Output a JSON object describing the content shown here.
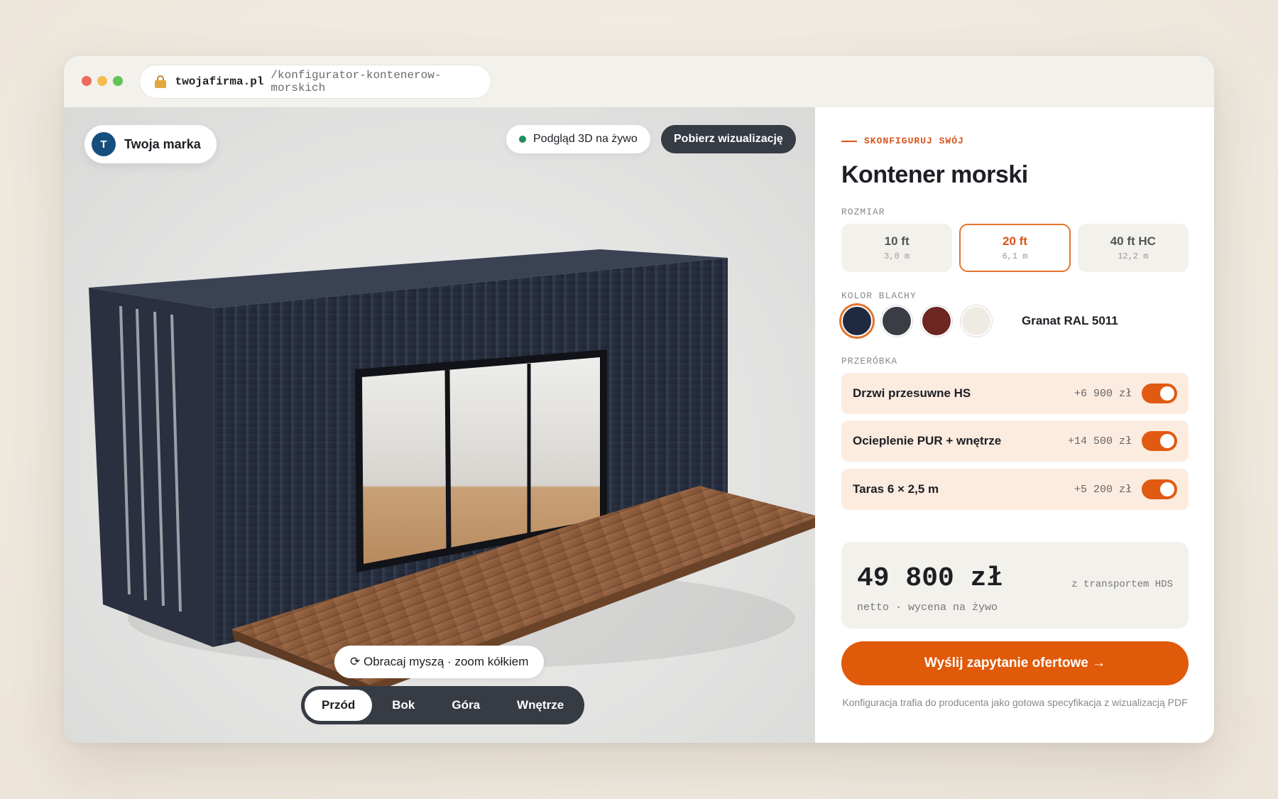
{
  "browser": {
    "domain": "twojafirma.pl",
    "path": "/konfigurator-kontenerow-morskich"
  },
  "viewer": {
    "brand": {
      "initial": "T",
      "name": "Twoja marka"
    },
    "live_label": "Podgląd 3D na żywo",
    "download_label": "Pobierz wizualizację",
    "hint": "⟳ Obracaj myszą · zoom kółkiem",
    "views": [
      {
        "label": "Przód",
        "active": true
      },
      {
        "label": "Bok",
        "active": false
      },
      {
        "label": "Góra",
        "active": false
      },
      {
        "label": "Wnętrze",
        "active": false
      }
    ]
  },
  "config": {
    "eyebrow": "SKONFIGURUJ SWÓJ",
    "title": "Kontener morski",
    "size_label": "ROZMIAR",
    "sizes": [
      {
        "name": "10 ft",
        "length": "3,0 m",
        "selected": false
      },
      {
        "name": "20 ft",
        "length": "6,1 m",
        "selected": true
      },
      {
        "name": "40 ft HC",
        "length": "12,2 m",
        "selected": false
      }
    ],
    "color_label": "KOLOR BLACHY",
    "colors": [
      {
        "hex": "#1f2a40",
        "selected": true
      },
      {
        "hex": "#3a3e44",
        "selected": false
      },
      {
        "hex": "#6e2620",
        "selected": false
      },
      {
        "hex": "#efebe3",
        "selected": false
      }
    ],
    "selected_color_name": "Granat RAL 5011",
    "conversion_label": "PRZERÓBKA",
    "options": [
      {
        "label": "Drzwi przesuwne HS",
        "price": "+6 900 zł",
        "enabled": true
      },
      {
        "label": "Ocieplenie PUR + wnętrze",
        "price": "+14 500 zł",
        "enabled": true
      },
      {
        "label": "Taras 6 × 2,5 m",
        "price": "+5 200 zł",
        "enabled": true
      }
    ],
    "price": "49 800 zł",
    "price_note": "z transportem HDS",
    "price_sub": "netto · wycena na żywo",
    "cta": "Wyślij zapytanie ofertowe →",
    "footnote": "Konfiguracja trafia do producenta jako gotowa specyfikacja z wizualizacją PDF"
  },
  "colors": {
    "accent": "#e05a0a",
    "container": "#262c3a",
    "deck": "#8a5a3c"
  }
}
